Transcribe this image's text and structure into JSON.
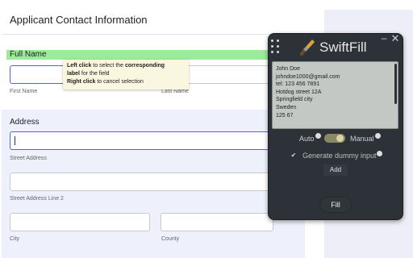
{
  "form": {
    "title": "Applicant Contact Information",
    "full_name": {
      "label": "Full Name",
      "first_name_label": "First Name",
      "last_name_label": "Last Name"
    },
    "address": {
      "title": "Address",
      "street_label": "Street Address",
      "street2_label": "Street Address Line 2",
      "city_label": "City",
      "county_label": "County"
    }
  },
  "tooltip": {
    "left_click": "Left click",
    "left_text_1": " to select the ",
    "corresponding": "corresponding",
    "label_text": "label",
    "left_text_2": " for the field",
    "right_click": "Right click",
    "right_text": " to cancel selection"
  },
  "swiftfill": {
    "brand": "SwiftFill",
    "minimize_glyph": "–",
    "close_glyph": "✕",
    "textarea_lines": [
      "John Doe",
      "johndoe1000@gmail.com",
      "tel: 123 456 7891",
      "Hotdog street 12A",
      "Springfield city",
      "Sweden",
      "125 67"
    ],
    "auto_label": "Auto",
    "manual_label": "Manual",
    "mode": "manual",
    "generate_checked": true,
    "generate_label": "Generate dummy input",
    "add_label": "Add",
    "fill_label": "Fill"
  },
  "colors": {
    "highlight": "#9aeb9a",
    "panel_bg": "#2c3237",
    "focus_border": "#4a67d8",
    "toggle_on": "#8a8866"
  },
  "icons": [
    "grip-icon",
    "paintbrush-icon",
    "minimize-icon",
    "close-icon",
    "info-icon",
    "check-icon"
  ]
}
